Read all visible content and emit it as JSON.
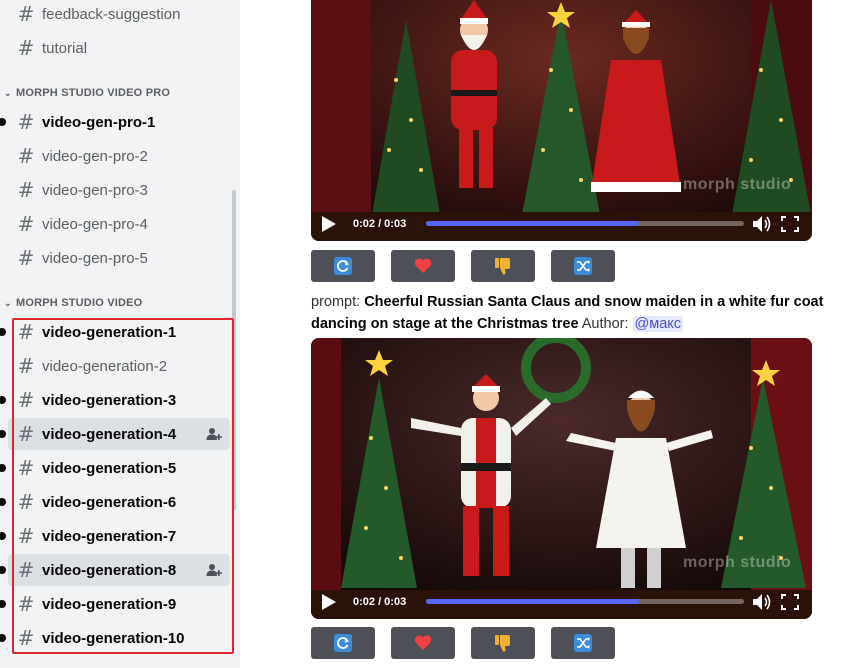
{
  "sidebar": {
    "top_channels": [
      {
        "label": "feedback-suggestion"
      },
      {
        "label": "tutorial"
      }
    ],
    "categories": [
      {
        "label": "MORPH STUDIO VIDEO PRO",
        "channels": [
          {
            "label": "video-gen-pro-1",
            "unread": true
          },
          {
            "label": "video-gen-pro-2",
            "unread": false
          },
          {
            "label": "video-gen-pro-3",
            "unread": false
          },
          {
            "label": "video-gen-pro-4",
            "unread": false
          },
          {
            "label": "video-gen-pro-5",
            "unread": false
          }
        ]
      },
      {
        "label": "MORPH STUDIO VIDEO",
        "channels": [
          {
            "label": "video-generation-1",
            "unread": true
          },
          {
            "label": "video-generation-2",
            "unread": false
          },
          {
            "label": "video-generation-3",
            "unread": true
          },
          {
            "label": "video-generation-4",
            "unread": true,
            "selected": true,
            "invite_icon": "add-member-icon"
          },
          {
            "label": "video-generation-5",
            "unread": true
          },
          {
            "label": "video-generation-6",
            "unread": true
          },
          {
            "label": "video-generation-7",
            "unread": true
          },
          {
            "label": "video-generation-8",
            "unread": true,
            "selected": true,
            "invite_icon": "add-member-icon"
          },
          {
            "label": "video-generation-9",
            "unread": true
          },
          {
            "label": "video-generation-10",
            "unread": true
          }
        ]
      }
    ],
    "highlight_color": "#e1262a"
  },
  "messages": [
    {
      "video": {
        "time": "0:02 / 0:03",
        "progress": 0.67,
        "watermark": "morph studio"
      },
      "buttons": [
        {
          "name": "regenerate-button",
          "icon": "refresh-icon"
        },
        {
          "name": "like-button",
          "icon": "heart-icon"
        },
        {
          "name": "dislike-button",
          "icon": "thumbs-down-icon"
        },
        {
          "name": "shuffle-button",
          "icon": "shuffle-icon"
        }
      ]
    },
    {
      "prompt_prefix": "prompt: ",
      "prompt_text": "Cheerful Russian Santa Claus and snow maiden in a white fur coat dancing on stage at the Christmas tree",
      "author_label": " Author:",
      "author_mention": "@макс",
      "video": {
        "time": "0:02 / 0:03",
        "progress": 0.67,
        "watermark": "morph studio"
      },
      "buttons": [
        {
          "name": "regenerate-button",
          "icon": "refresh-icon"
        },
        {
          "name": "like-button",
          "icon": "heart-icon"
        },
        {
          "name": "dislike-button",
          "icon": "thumbs-down-icon"
        },
        {
          "name": "shuffle-button",
          "icon": "shuffle-icon"
        }
      ]
    }
  ],
  "colors": {
    "accent": "#5865f2",
    "button_bg": "#4e5058",
    "heart": "#f23f43",
    "thumb": "#f0b232",
    "refresh_shuffle": "#3b8ddb"
  }
}
